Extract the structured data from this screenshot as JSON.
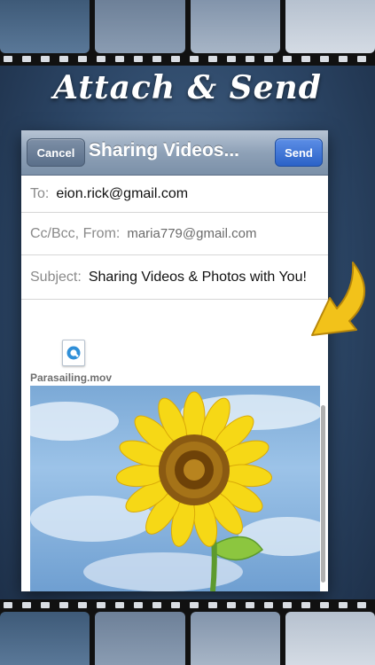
{
  "headline": "Attach & Send",
  "compose": {
    "cancel_label": "Cancel",
    "title": "Sharing Videos...",
    "send_label": "Send",
    "to_label": "To:",
    "to_value": "eion.rick@gmail.com",
    "cc_label": "Cc/Bcc, From:",
    "cc_value": "maria779@gmail.com",
    "subject_label": "Subject:",
    "subject_value": "Sharing Videos & Photos with You!",
    "attachment_name": "Parasailing.mov",
    "attachment_icon": "quicktime-icon"
  },
  "colors": {
    "accent_send": "#2b62c8",
    "arrow": "#f2c21a"
  }
}
